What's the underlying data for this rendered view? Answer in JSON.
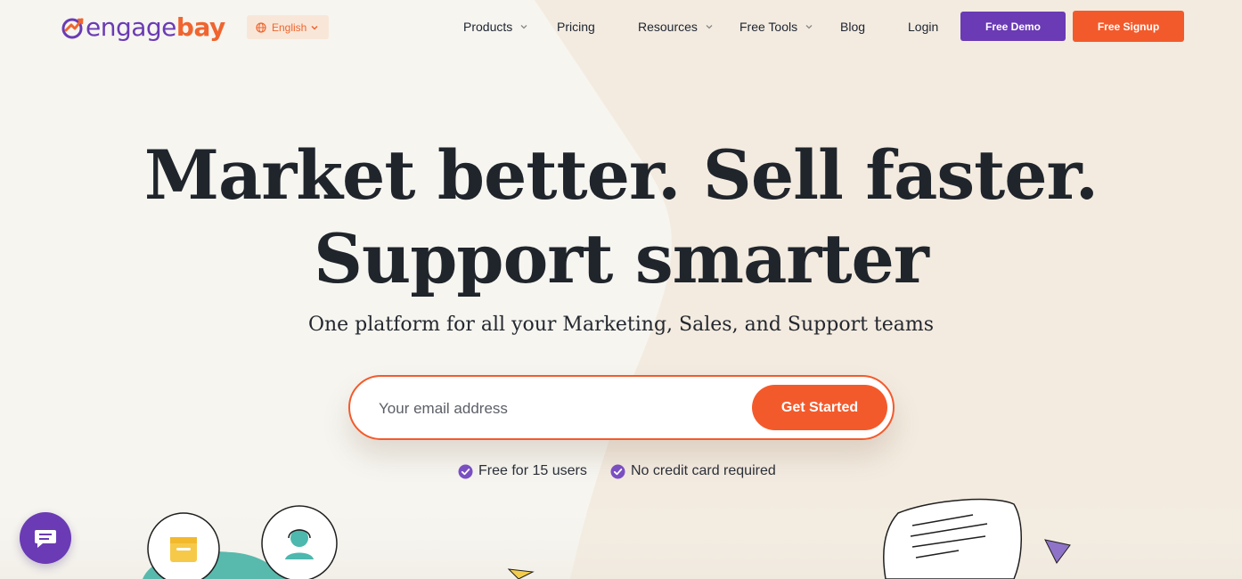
{
  "brand": {
    "name_part1": "engage",
    "name_part2": "bay",
    "purple": "#6a3bb4",
    "orange": "#f35a2b"
  },
  "language": {
    "label": "English"
  },
  "nav": {
    "products": "Products",
    "pricing": "Pricing",
    "resources": "Resources",
    "free_tools": "Free Tools",
    "blog": "Blog",
    "login": "Login",
    "free_demo": "Free Demo",
    "free_signup": "Free Signup"
  },
  "hero": {
    "title_line1": "Market better. Sell faster.",
    "title_line2": "Support smarter",
    "subtitle": "One platform for all your Marketing, Sales, and Support teams",
    "email_placeholder": "Your email address",
    "cta": "Get Started",
    "perks": [
      "Free for 15 users",
      "No credit card required"
    ]
  },
  "icons": {
    "globe": "globe-icon",
    "chevron": "chevron-down-icon",
    "check": "check-circle-icon",
    "chat": "chat-icon"
  }
}
